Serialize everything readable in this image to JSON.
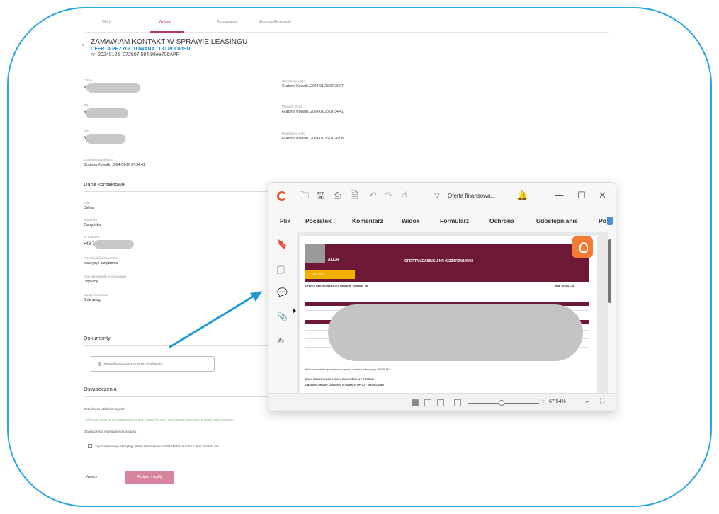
{
  "tabs": [
    "Oferty",
    "Wnioski",
    "Rozpoznanie",
    "Zbiorcze Akceptacje"
  ],
  "header": {
    "title": "ZAMAWIAM KONTAKT W SPRAWIE LEASINGU",
    "status": "OFERTA PRZYGOTOWANA",
    "status_sep": "›",
    "status_next": "DO PODPISU",
    "number": "nr: 20240126_072607.594.98ee706APP"
  },
  "fields_left": [
    {
      "label": "Firma",
      "prefix": "A"
    },
    {
      "label": "OS",
      "prefix": "4"
    },
    {
      "label": "NIP",
      "prefix": "3"
    }
  ],
  "last_modified": {
    "label": "Ostatnia modyfikacja",
    "value": "Grażyna Kowalik, 2024-01-26 07:34:41"
  },
  "fields_right": [
    {
      "label": "Utworzony przez",
      "value": "Grażyna Kowalik, 2024-01-26 07:26:07"
    },
    {
      "label": "Przejęty przez",
      "value": "Grażyna Kowalik, 2024-01-26 07:34:41"
    },
    {
      "label": "Podpisany przez",
      "value": "Grażyna Kowalik, 2024-01-26 07:26:08"
    }
  ],
  "contact": {
    "section_title": "Dane kontaktowe",
    "items": [
      {
        "label": "Imię",
        "value": "Celina"
      },
      {
        "label": "Nazwisko",
        "value": "Zaczyńska"
      },
      {
        "label": "Nr telefonu",
        "value": "+48 7"
      },
      {
        "label": "Przedmiot finansowania",
        "value": "Maszyny i urządzenia"
      },
      {
        "label": "Stan przedmiotu finansowania",
        "value": "Używany"
      },
      {
        "label": "Uwagi dodatkowe",
        "value": "Brak uwag"
      }
    ]
  },
  "documents": {
    "section_title": "Dokumenty",
    "file_label": "Oferta finansowania nr 932347/24/1/K/02"
  },
  "statements": {
    "section_title": "Oświadczenia",
    "given_label": "Dotychczas udzielone zgody:",
    "given_note": "✓ Wyrażam zgodę na przetwarzanie przez Alior Leasing Sp. z o.o. moich danych osobowych w celach marketingowych",
    "required_label": "Oświadczenia wymagane do podpisu:",
    "required_check": "Zapoznałem się i akceptuję ofertę finansowania nr 932347/24/1/K/02 z dnia 2024-01-26"
  },
  "footer": {
    "back": "‹ Wstecz",
    "submit": "Podpisz i wyślij"
  },
  "viewer": {
    "doc_title": "Oferta finansowa...",
    "menu": [
      "Plik",
      "Początek",
      "Komentarz",
      "Widok",
      "Formularz",
      "Ochrona",
      "Udostępnianie",
      "Po"
    ],
    "zoom": "67,54%",
    "pdf": {
      "brand": "ALIOR",
      "brand_sub": "LEASING",
      "offer_title": "OFERTA LEASINGU NR 932347/24/1/K/02",
      "subline": "OFERTA OBEJMOWANA DO: MINIMUM_Oprafuss_DB",
      "date": "data: 2024-01-26",
      "line1": "Kalkulacja została sporządzona w oparciu o stawkę referencyjną WIBOR 1M.",
      "line2": "BRAK DODATKOWEJ OPŁATY ZA WEJŚCIE W PROGRAM",
      "line3": "OBSŁUGA UMOWY LEASINGU W RAMACH OPŁATY MIESIĘCZNEJ"
    }
  },
  "colors": {
    "accent": "#b83c5a",
    "link": "#1e8fd6",
    "frame": "#2aa6df",
    "pdf_header": "#6d1836",
    "leasing": "#f3b000",
    "arrow": "#1f9ad6"
  }
}
